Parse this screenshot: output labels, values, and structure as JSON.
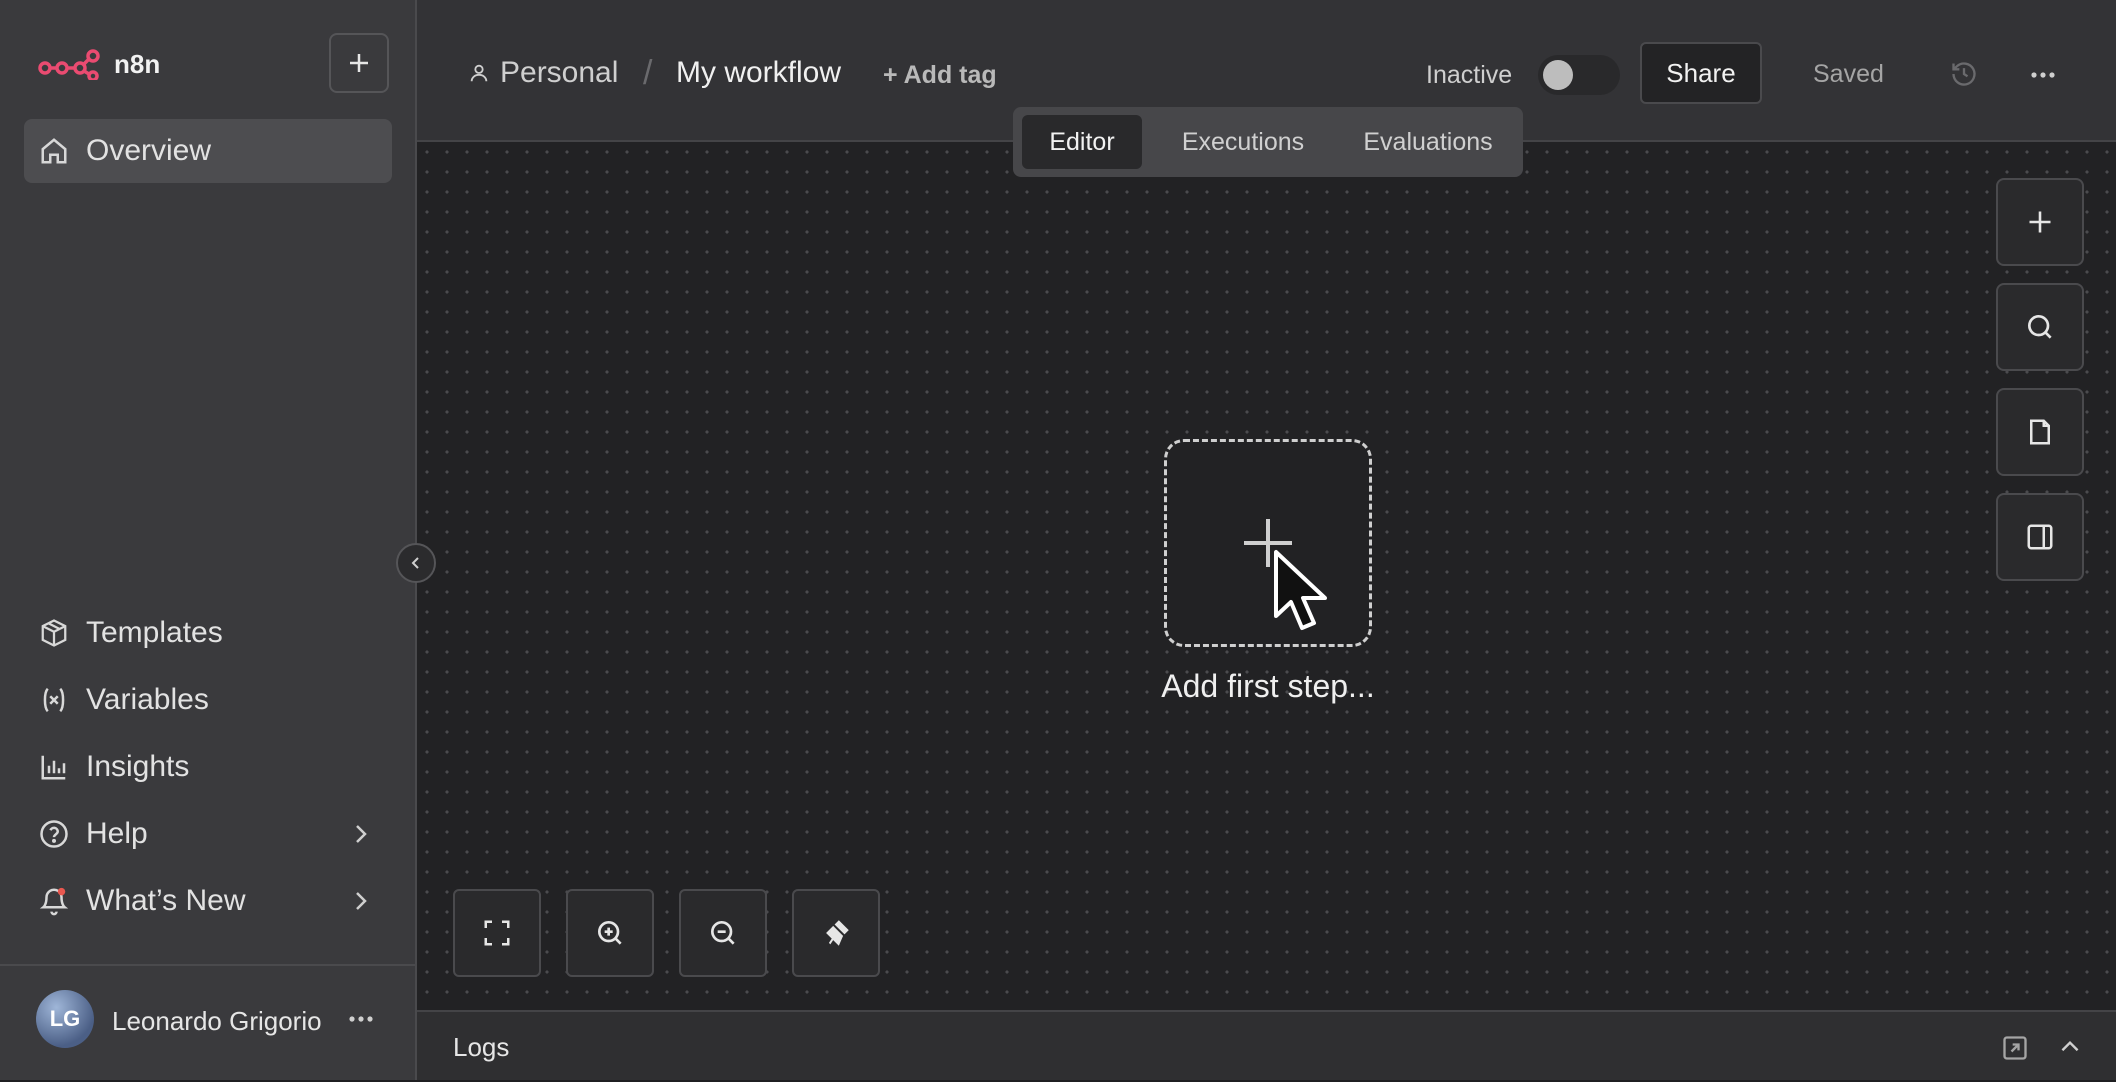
{
  "app": {
    "brand": "n8n",
    "brand_color": "#ea4b71"
  },
  "sidebar": {
    "new_button_icon": "plus-icon",
    "primary": [
      {
        "label": "Overview",
        "icon": "home-icon",
        "active": true
      }
    ],
    "bottom": [
      {
        "label": "Templates",
        "icon": "box-icon"
      },
      {
        "label": "Variables",
        "icon": "variable-icon"
      },
      {
        "label": "Insights",
        "icon": "bar-chart-icon"
      },
      {
        "label": "Help",
        "icon": "help-circle-icon",
        "chevron": true
      },
      {
        "label": "What’s New",
        "icon": "bell-icon",
        "chevron": true,
        "notification_dot": "#e8574f"
      }
    ],
    "user": {
      "initials": "LG",
      "name": "Leonardo Grigorio",
      "more_icon": "ellipsis-icon"
    }
  },
  "header": {
    "project": "Personal",
    "separator": "/",
    "workflow_name": "My workflow",
    "add_tag": "+ Add tag",
    "status_label": "Inactive",
    "active": false,
    "share_label": "Share",
    "save_state": "Saved",
    "tabs": [
      {
        "label": "Editor",
        "active": true
      },
      {
        "label": "Executions"
      },
      {
        "label": "Evaluations"
      }
    ]
  },
  "canvas": {
    "add_first_step_label": "Add first step...",
    "right_tools": [
      "plus-icon",
      "search-icon",
      "sticky-note-icon",
      "panel-right-icon"
    ],
    "bottom_tools": [
      "fit-view-icon",
      "zoom-in-icon",
      "zoom-out-icon",
      "tidy-up-icon"
    ]
  },
  "logs": {
    "label": "Logs"
  }
}
